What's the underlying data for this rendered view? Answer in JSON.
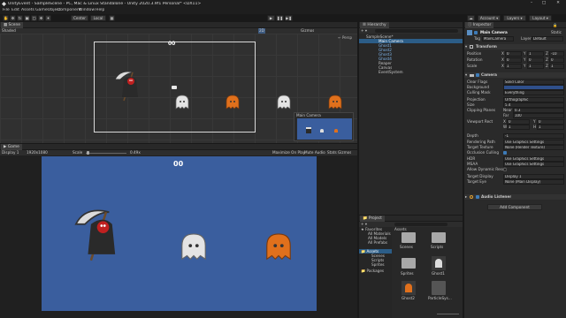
{
  "window": {
    "title": "UnityEvent - SampleScene - PC, Mac & Linux Standalone - Unity 2020.3.9f1 Personal* <DX11>"
  },
  "menu": [
    "File",
    "Edit",
    "Assets",
    "GameObject",
    "Component",
    "Window",
    "Help"
  ],
  "toolbar": {
    "center_label": "Center",
    "local_label": "Local",
    "account_label": "Account",
    "layers_label": "Layers",
    "layout_label": "Layout"
  },
  "scene": {
    "tab_label": "Scene",
    "shading_mode": "Shaded",
    "mode_2d": "2D",
    "gizmos_label": "Gizmos",
    "score_text": "00",
    "camera_preview_title": "Main Camera"
  },
  "game": {
    "tab_label": "Game",
    "display": "Display 1",
    "resolution": "1920x1080",
    "scale_label": "Scale",
    "scale_value": "0.49x",
    "maximize_label": "Maximize On Play",
    "mute_label": "Mute Audio",
    "stats_label": "Stats",
    "gizmos_label": "Gizmos",
    "score_text": "00",
    "background_color": "#3a5e9e"
  },
  "hierarchy": {
    "tab_label": "Hierarchy",
    "items": [
      {
        "label": "SampleScene*",
        "depth": 0,
        "selected": false,
        "prefab": false
      },
      {
        "label": "Main Camera",
        "depth": 1,
        "selected": true,
        "prefab": false
      },
      {
        "label": "Ghost1",
        "depth": 1,
        "selected": false,
        "prefab": true
      },
      {
        "label": "Ghost2",
        "depth": 1,
        "selected": false,
        "prefab": true
      },
      {
        "label": "Ghost3",
        "depth": 1,
        "selected": false,
        "prefab": true
      },
      {
        "label": "Ghost4",
        "depth": 1,
        "selected": false,
        "prefab": true
      },
      {
        "label": "Reaper",
        "depth": 1,
        "selected": false,
        "prefab": false
      },
      {
        "label": "Canvas",
        "depth": 1,
        "selected": false,
        "prefab": false
      },
      {
        "label": "EventSystem",
        "depth": 1,
        "selected": false,
        "prefab": false
      }
    ]
  },
  "inspector": {
    "tab_label": "Inspector",
    "object_name": "Main Camera",
    "static_label": "Static",
    "tag_label": "Tag",
    "tag_value": "MainCamera",
    "layer_label": "Layer",
    "layer_value": "Default",
    "transform": {
      "title": "Transform",
      "rows": [
        {
          "label": "Position",
          "x": "0",
          "y": "1",
          "z": "-10"
        },
        {
          "label": "Rotation",
          "x": "0",
          "y": "0",
          "z": "0"
        },
        {
          "label": "Scale",
          "x": "1",
          "y": "1",
          "z": "1"
        }
      ]
    },
    "camera": {
      "title": "Camera",
      "rows": [
        {
          "label": "Clear Flags",
          "value": "Solid Color"
        },
        {
          "label": "Background",
          "value": ""
        },
        {
          "label": "Culling Mask",
          "value": "Everything"
        },
        {
          "label": "Projection",
          "value": "Orthographic"
        },
        {
          "label": "Size",
          "value": "5.4"
        },
        {
          "label": "Clipping Planes",
          "value": ""
        },
        {
          "label": "",
          "value": ""
        },
        {
          "label": "Viewport Rect",
          "value": ""
        },
        {
          "label": "",
          "value": ""
        },
        {
          "label": "Depth",
          "value": "-1"
        },
        {
          "label": "Rendering Path",
          "value": "Use Graphics Settings"
        },
        {
          "label": "Target Texture",
          "value": "None (Render Texture)"
        },
        {
          "label": "Occlusion Culling",
          "value": ""
        },
        {
          "label": "HDR",
          "value": "Use Graphics Settings"
        },
        {
          "label": "MSAA",
          "value": "Use Graphics Settings"
        },
        {
          "label": "Allow Dynamic Resol",
          "value": ""
        },
        {
          "label": "Target Display",
          "value": "Display 1"
        },
        {
          "label": "Target Eye",
          "value": "None (Main Display)"
        }
      ],
      "near_label": "Near",
      "near_value": "0.3",
      "far_label": "Far",
      "far_value": "100",
      "x_label": "X",
      "x_value": "0",
      "y_label": "Y",
      "y_value": "0",
      "w_label": "W",
      "w_value": "1",
      "h_label": "H",
      "h_value": "1"
    },
    "audio_listener_title": "Audio Listener",
    "add_component_label": "Add Component"
  },
  "project": {
    "tab_label": "Project",
    "favorites_label": "Favorites",
    "favorites": [
      "All Materials",
      "All Models",
      "All Prefabs"
    ],
    "assets_label": "Assets",
    "asset_folders": [
      "Scenes",
      "Scripts",
      "Sprites"
    ],
    "packages_label": "Packages",
    "breadcrumb": "Assets",
    "grid_items": [
      "Scenes",
      "Scripts",
      "Sprites",
      "Ghost1",
      "Ghost2",
      "ParticleSys..."
    ]
  },
  "colors": {
    "accent": "#3d7bb8",
    "selection": "#2c5d87",
    "game_bg": "#3a5e9e"
  }
}
